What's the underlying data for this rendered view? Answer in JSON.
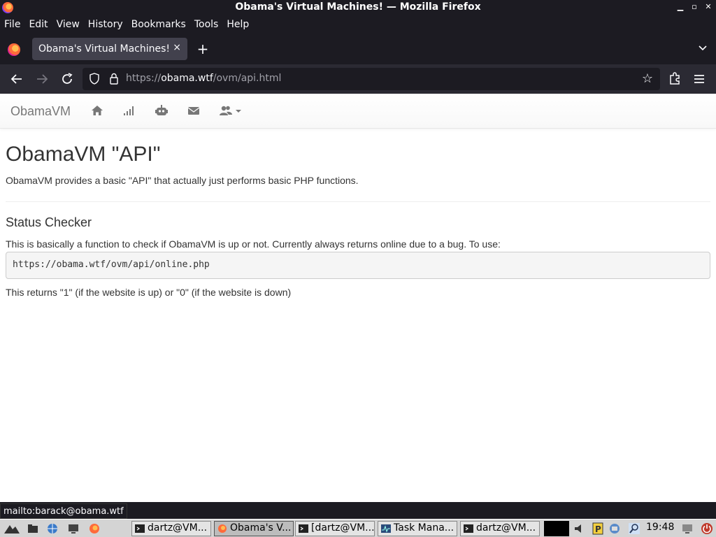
{
  "window": {
    "title": "Obama's Virtual Machines! — Mozilla Firefox"
  },
  "menubar": {
    "items": [
      {
        "label": "File"
      },
      {
        "label": "Edit"
      },
      {
        "label": "View"
      },
      {
        "label": "History"
      },
      {
        "label": "Bookmarks"
      },
      {
        "label": "Tools"
      },
      {
        "label": "Help"
      }
    ]
  },
  "tab": {
    "title": "Obama's Virtual Machines!",
    "close": "×",
    "new_tab": "+"
  },
  "urlbar": {
    "prefix": "https://",
    "domain": "obama.wtf",
    "path": "/ovm/api.html"
  },
  "site_nav": {
    "brand": "ObamaVM",
    "icons": [
      "home-icon",
      "signal-icon",
      "robot-icon",
      "envelope-icon",
      "users-icon"
    ]
  },
  "content": {
    "title": "ObamaVM \"API\"",
    "lead": "ObamaVM provides a basic \"API\" that actually just performs basic PHP functions.",
    "section_title": "Status Checker",
    "description": "This is basically a function to check if ObamaVM is up or not. Currently always returns online due to a bug. To use:",
    "code": "https://obama.wtf/ovm/api/online.php",
    "returns": "This returns \"1\" (if the website is up) or \"0\" (if the website is down)"
  },
  "statusbar": {
    "text": "mailto:barack@obama.wtf"
  },
  "taskbar": {
    "tasks": [
      {
        "label": "dartz@VM...",
        "icon": "terminal-icon"
      },
      {
        "label": "Obama's V...",
        "icon": "firefox-icon",
        "active": true
      },
      {
        "label": "[dartz@VM...",
        "icon": "terminal-icon"
      },
      {
        "label": "Task Mana...",
        "icon": "task-manager-icon"
      },
      {
        "label": "dartz@VM...",
        "icon": "terminal-icon"
      }
    ],
    "clock": "19:48"
  }
}
